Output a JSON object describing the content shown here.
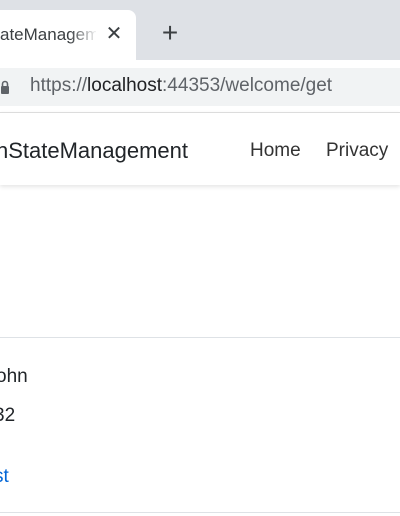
{
  "browser": {
    "tab": {
      "title": "ateManagem",
      "close_glyph": "✕"
    },
    "new_tab_glyph": "+",
    "address": {
      "scheme": "https://",
      "host": "localhost",
      "path": ":44353/welcome/get"
    }
  },
  "navbar": {
    "brand": "hStateManagement",
    "links": [
      "Home",
      "Privacy"
    ]
  },
  "content": {
    "name_text": "ohn",
    "number_text": "32",
    "link_text": "st"
  },
  "icons": {
    "lock": "lock-icon",
    "close": "close-icon",
    "new_tab": "plus-icon"
  },
  "colors": {
    "link": "#0366d6",
    "tabstrip": "#dee1e6",
    "omnibox": "#f1f3f4"
  }
}
